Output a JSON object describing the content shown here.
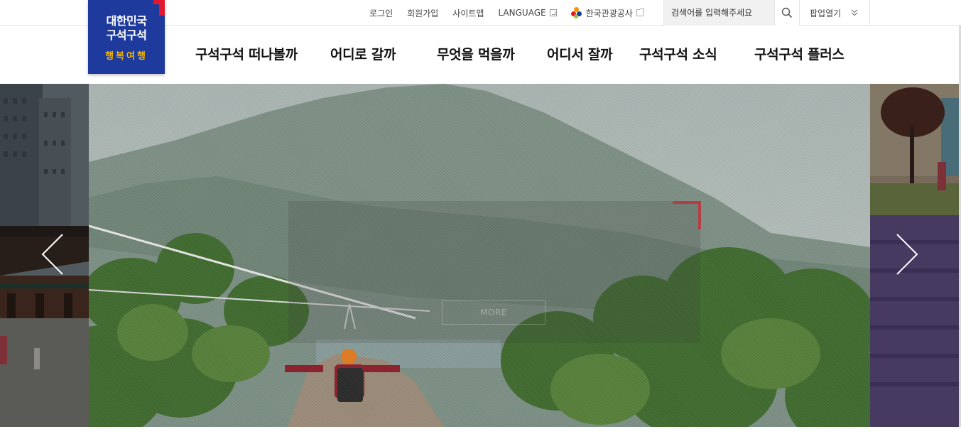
{
  "utility": {
    "login": "로그인",
    "signup": "회원가입",
    "sitemap": "사이트맵",
    "language": "LANGUAGE",
    "kto": "한국관광공사",
    "search_placeholder": "검색어를 입력해주세요",
    "popup": "팝업열기"
  },
  "logo": {
    "line1": "대한민국",
    "line2": "구석구석",
    "line3": "행복여행"
  },
  "nav": [
    "구석구석 떠나볼까",
    "어디로 갈까",
    "무엇을 먹을까",
    "어디서 잘까",
    "구석구석 소식",
    "구석구석 플러스"
  ],
  "slider": {
    "more_label": "MORE"
  },
  "colors": {
    "brand_blue": "#1d3a9c",
    "brand_red": "#e3172d",
    "brand_yellow": "#f4b400"
  },
  "icons": {
    "search": "search-icon",
    "popup": "chevron-down-double-icon",
    "prev": "chevron-left-icon",
    "next": "chevron-right-icon"
  }
}
